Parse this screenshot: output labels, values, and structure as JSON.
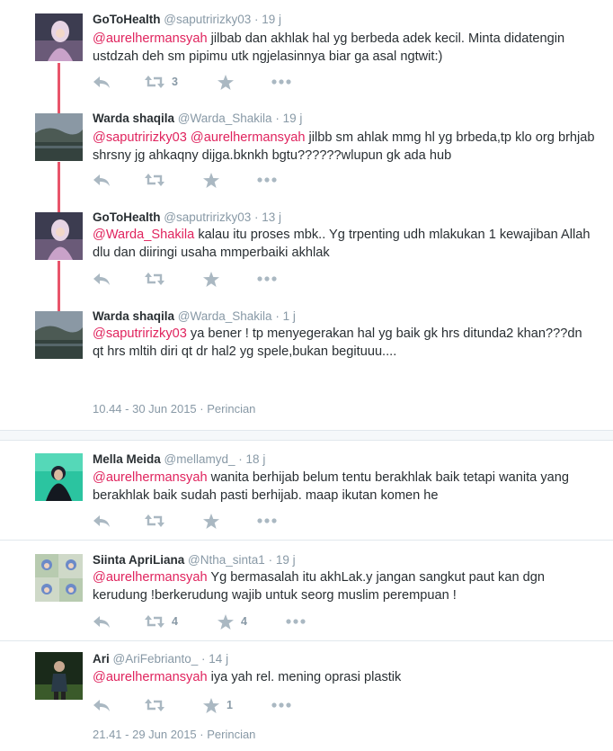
{
  "thread1": {
    "tweets": [
      {
        "name": "GoToHealth",
        "handle": "@saputririzky03",
        "time": "19 j",
        "mentions": [
          "@aurelhermansyah"
        ],
        "text": "jilbab dan akhlak hal yg berbeda adek kecil. Minta didatengin ustdzah deh sm pipimu utk ngjelasinnya biar ga asal ngtwit:)",
        "retweets": "3",
        "likes": ""
      },
      {
        "name": "Warda shaqila",
        "handle": "@Warda_Shakila",
        "time": "19 j",
        "mentions": [
          "@saputririzky03",
          "@aurelhermansyah"
        ],
        "text": "jilbb sm ahlak mmg hl yg brbeda,tp klo org brhjab shrsny jg ahkaqny dijga.bknkh bgtu??????wlupun gk ada hub",
        "retweets": "",
        "likes": ""
      },
      {
        "name": "GoToHealth",
        "handle": "@saputririzky03",
        "time": "13 j",
        "mentions": [
          "@Warda_Shakila"
        ],
        "text": "kalau itu proses mbk.. Yg trpenting udh mlakukan 1 kewajiban Allah dlu dan diiringi usaha mmperbaiki akhlak",
        "retweets": "",
        "likes": ""
      },
      {
        "name": "Warda shaqila",
        "handle": "@Warda_Shakila",
        "time": "1 j",
        "mentions": [
          "@saputririzky03"
        ],
        "text": "ya bener ! tp menyegerakan hal yg baik gk hrs ditunda2 khan???dn qt hrs mltih diri qt dr hal2 yg spele,bukan begituuu....",
        "retweets": "",
        "likes": ""
      }
    ],
    "timestamp": "10.44 - 30 Jun 2015",
    "details_link": "Perincian"
  },
  "thread2": {
    "tweets": [
      {
        "name": "Mella Meida",
        "handle": "@mellamyd_",
        "time": "18 j",
        "mentions": [
          "@aurelhermansyah"
        ],
        "text": "wanita berhijab belum tentu berakhlak baik tetapi wanita yang berakhlak baik sudah pasti berhijab. maap ikutan komen he",
        "retweets": "",
        "likes": ""
      },
      {
        "name": "Siinta ApriLiana",
        "handle": "@Ntha_sinta1",
        "time": "19 j",
        "mentions": [
          "@aurelhermansyah"
        ],
        "text": "Yg bermasalah itu akhLak.y jangan sangkut paut kan dgn kerudung !berkerudung wajib untuk seorg muslim perempuan !",
        "retweets": "4",
        "likes": "4"
      },
      {
        "name": "Ari",
        "handle": "@AriFebrianto_",
        "time": "14 j",
        "mentions": [
          "@aurelhermansyah"
        ],
        "text": "iya yah rel. mening oprasi plastik",
        "retweets": "",
        "likes": "1"
      }
    ],
    "timestamp": "21.41 - 29 Jun 2015",
    "details_link": "Perincian"
  },
  "separator": " · ",
  "icons": [
    "reply-icon",
    "retweet-icon",
    "like-star-icon",
    "more-dots-icon"
  ],
  "colors": {
    "mention": "#e0245e",
    "thread_line": "#e8546a",
    "muted": "#8899a6"
  }
}
